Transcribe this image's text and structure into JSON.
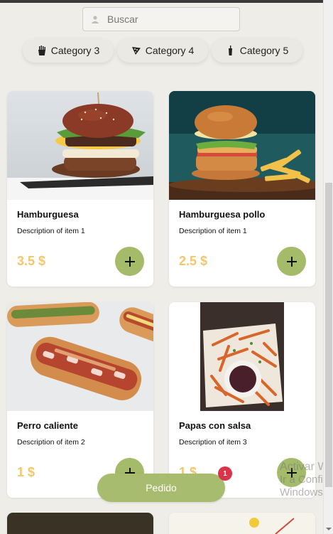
{
  "search": {
    "placeholder": "Buscar"
  },
  "categories": [
    {
      "label": "Category 3",
      "icon": "french-fries-icon"
    },
    {
      "label": "Category 4",
      "icon": "pizza-slice-icon"
    },
    {
      "label": "Category 5",
      "icon": "drink-icon"
    }
  ],
  "items": [
    {
      "name": "Hamburguesa",
      "description": "Description of item 1",
      "price": "3.5 $",
      "add_label": "+"
    },
    {
      "name": "Hamburguesa pollo",
      "description": "Description of item 1",
      "price": "2.5 $",
      "add_label": "+"
    },
    {
      "name": "Perro caliente",
      "description": "Description of item 2",
      "price": "1 $",
      "add_label": "+"
    },
    {
      "name": "Papas con salsa",
      "description": "Description of item 3",
      "price": "1 $",
      "add_label": "+"
    }
  ],
  "order": {
    "label": "Pedido",
    "badge_count": "1"
  },
  "watermark": {
    "line1": "Activar Windows",
    "line2": "Ir a Configuración para activar",
    "line3": "Windows."
  },
  "colors": {
    "accent_green": "#a8bc6f",
    "price_gold": "#f3c66c",
    "badge_red": "#d9344a",
    "background": "#efede8"
  }
}
